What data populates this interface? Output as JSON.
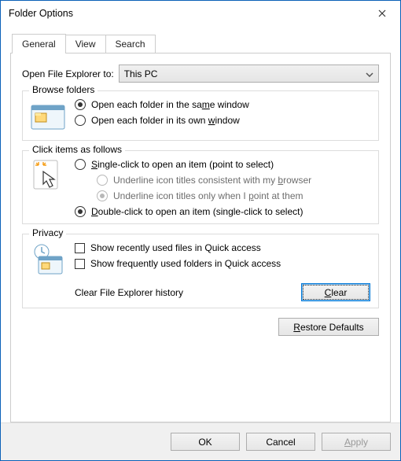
{
  "window": {
    "title": "Folder Options"
  },
  "tabs": {
    "general": "General",
    "view": "View",
    "search": "Search"
  },
  "open_with": {
    "label": "Open File Explorer to:",
    "selected": "This PC"
  },
  "browse": {
    "legend": "Browse folders",
    "same_pre": "Open each folder in the sa",
    "same_u": "m",
    "same_post": "e window",
    "own_pre": "Open each folder in its own ",
    "own_u": "w",
    "own_post": "indow"
  },
  "click": {
    "legend": "Click items as follows",
    "single_u": "S",
    "single_post": "ingle-click to open an item (point to select)",
    "u1_pre": "Underline icon titles consistent with my ",
    "u1_u": "b",
    "u1_post": "rowser",
    "u2_pre": "Underline icon titles only when I ",
    "u2_u": "p",
    "u2_post": "oint at them",
    "double_u": "D",
    "double_post": "ouble-click to open an item (single-click to select)"
  },
  "privacy": {
    "legend": "Privacy",
    "recent": "Show recently used files in Quick access",
    "frequent": "Show frequently used folders in Quick access",
    "clear_label": "Clear File Explorer history",
    "clear_u": "C",
    "clear_post": "lear"
  },
  "restore_u": "R",
  "restore_post": "estore Defaults",
  "buttons": {
    "ok": "OK",
    "cancel": "Cancel",
    "apply_u": "A",
    "apply_post": "pply"
  }
}
